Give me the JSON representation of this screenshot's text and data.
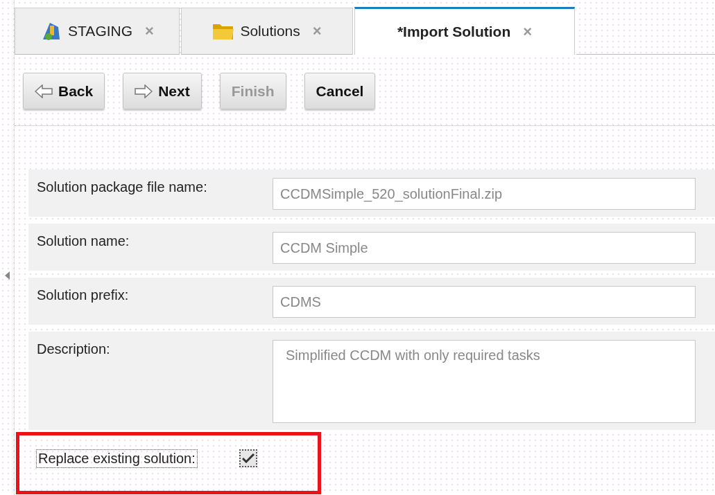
{
  "tabs": [
    {
      "label": "STAGING",
      "kind": "staging",
      "selected": false,
      "close": "×"
    },
    {
      "label": "Solutions",
      "kind": "folder",
      "selected": false,
      "close": "×"
    },
    {
      "label": "*Import Solution",
      "kind": "plain",
      "selected": true,
      "close": "×"
    }
  ],
  "toolbar": [
    {
      "label": "Back",
      "kind": "back",
      "disabled": false
    },
    {
      "label": "Next",
      "kind": "next",
      "disabled": false
    },
    {
      "label": "Finish",
      "kind": "plain",
      "disabled": true
    },
    {
      "label": "Cancel",
      "kind": "plain",
      "disabled": false
    }
  ],
  "fields": [
    {
      "kind": "input",
      "label": "Solution package file name:",
      "value": "CCDMSimple_520_solutionFinal.zip"
    },
    {
      "kind": "input",
      "label": "Solution name:",
      "value": "CCDM Simple"
    },
    {
      "kind": "input",
      "label": "Solution prefix:",
      "value": "CDMS"
    },
    {
      "kind": "textarea",
      "label": "Description:",
      "value": "Simplified CCDM with only required tasks"
    }
  ],
  "replace_option": {
    "label": "Replace existing solution:",
    "checked": true,
    "highlighted": true
  }
}
